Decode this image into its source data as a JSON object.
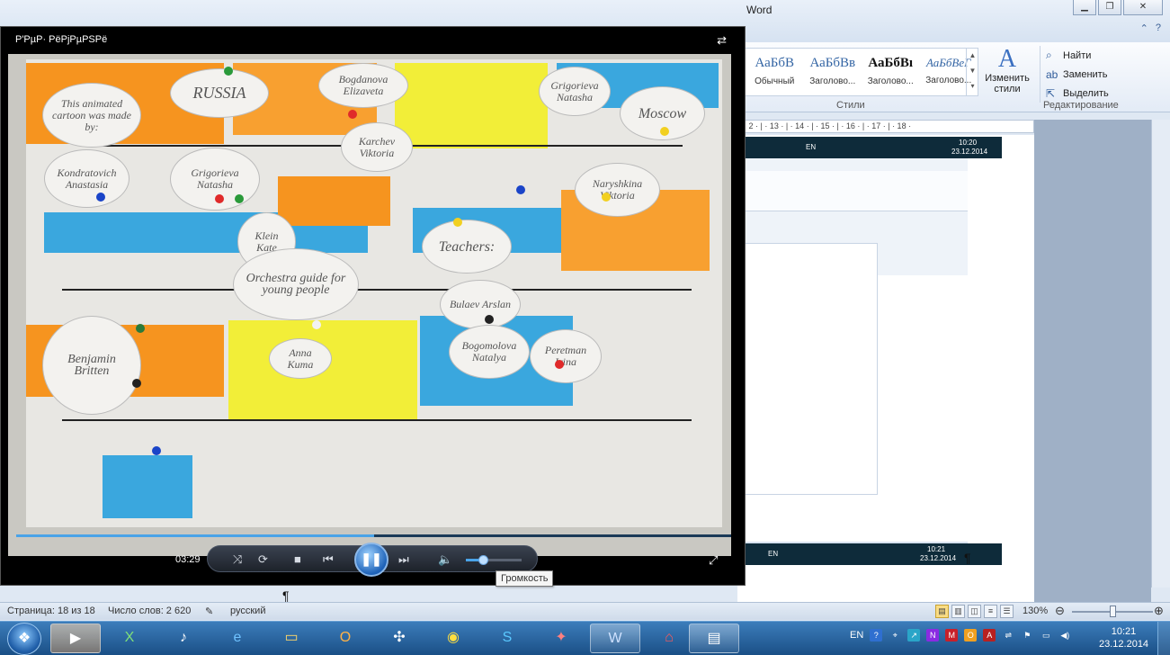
{
  "word": {
    "title": "Word",
    "styles": [
      {
        "sample": "АаБбВ",
        "name": "Обычный"
      },
      {
        "sample": "АаБбВв",
        "name": "Заголово..."
      },
      {
        "sample": "АаБбВı",
        "name": "Заголово..."
      },
      {
        "sample": "АаБбВеГ",
        "name": "Заголово..."
      }
    ],
    "change_styles": "Изменить стили",
    "styles_group": "Стили",
    "edit_items": [
      "Найти",
      "Заменить",
      "Выделить"
    ],
    "edit_group": "Редактирование",
    "ruler": "· 2 · | · 13 · | · 14 · | · 15 · | · 16 · | · 17 · | · 18 ·"
  },
  "nested": {
    "lang": "EN",
    "time1": "10:20",
    "date1": "23.12.2014",
    "time2": "10:21",
    "date2": "23.12.2014",
    "zoom": "130%"
  },
  "player": {
    "title": "Р'РµР· РёРјРµРЅРё",
    "time": "03:29",
    "tooltip": "Громкость",
    "progress": 0.5,
    "volume": 0.3,
    "video": {
      "bubbles": [
        "This animated cartoon was made by:",
        "RUSSIA",
        "Bogdanova Elizaveta",
        "Karchev Viktoria",
        "Moscow",
        "Grigorieva Natasha",
        "Klein Kate",
        "Kondratovich Anastasia",
        "Teachers:",
        "Naryshkina Viktoria",
        "Orchestra guide for young people",
        "Benjamin Britten",
        "Bulaev Arslan",
        "Bogomolova Natalya",
        "Peretman Irina",
        "Anna Kuma"
      ]
    }
  },
  "status": {
    "page": "Страница: 18 из 18",
    "words": "Число слов: 2 620",
    "lang": "русский",
    "zoom": "130%"
  },
  "taskbar": {
    "lang": "EN",
    "time": "10:21",
    "date": "23.12.2014"
  }
}
